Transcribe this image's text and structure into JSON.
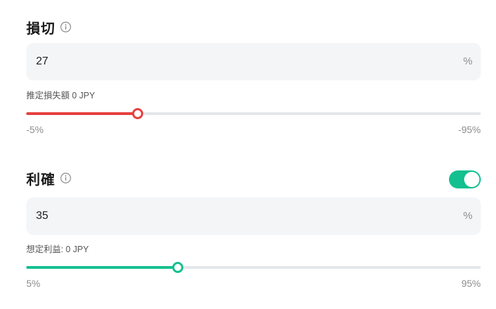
{
  "colors": {
    "stop_loss": "#e5403f",
    "take_profit": "#14c090"
  },
  "stop_loss": {
    "title": "損切",
    "value": "27",
    "unit": "%",
    "estimate_label": "推定損失額 0 JPY",
    "slider": {
      "min_label": "-5%",
      "max_label": "-95%",
      "fraction": 0.245
    },
    "info_icon": "info-circle-icon"
  },
  "take_profit": {
    "title": "利確",
    "enabled": true,
    "value": "35",
    "unit": "%",
    "estimate_label": "想定利益: 0 JPY",
    "slider": {
      "min_label": "5%",
      "max_label": "95%",
      "fraction": 0.333
    },
    "info_icon": "info-circle-icon"
  }
}
